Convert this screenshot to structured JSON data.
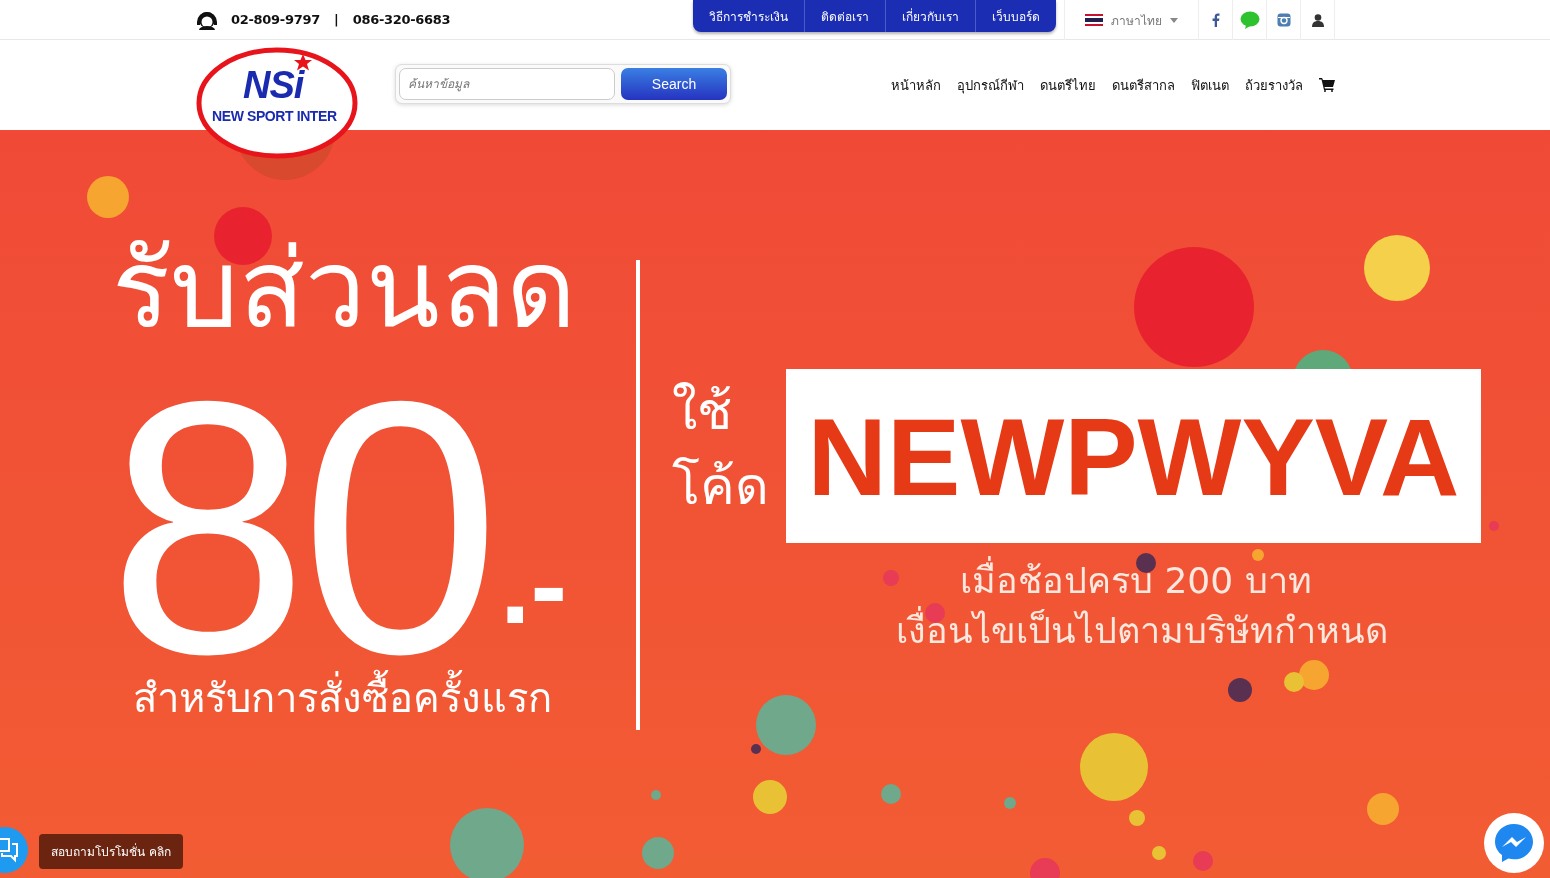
{
  "topbar": {
    "phones": [
      {
        "kind": "phone",
        "text": "02-809-9797"
      },
      {
        "kind": "separator",
        "text": "|"
      },
      {
        "kind": "phone",
        "text": "086-320-6683"
      }
    ],
    "links": [
      "วิธีการชำระเงิน",
      "ติดต่อเรา",
      "เกี่ยวกับเรา",
      "เว็บบอร์ด"
    ],
    "language": "ภาษาไทย"
  },
  "logo": {
    "mark": "NSi",
    "name": "NEW SPORT INTER"
  },
  "search": {
    "placeholder": "ค้นหาข้อมูล",
    "button": "Search"
  },
  "nav": [
    "หน้าหลัก",
    "อุปกรณ์กีฬา",
    "ดนตรีไทย",
    "ดนตรีสากล",
    "ฟิตเนต",
    "ถ้วยรางวัล"
  ],
  "banner": {
    "headline": "รับส่วนลด",
    "amount": "80",
    "suffix": ".-",
    "subline": "สำหรับการสั่งซื้อครั้งแรก",
    "use": "ใช้",
    "code_label": "โค้ด",
    "code": "NEWPWYVA",
    "condition_1": "เมื่อช้อปครบ 200 บาท",
    "condition_2": "เงื่อนไขเป็นไปตามบริษัทกำหนด"
  },
  "chat": {
    "tooltip": "สอบถามโปรโมชั่น คลิก"
  }
}
